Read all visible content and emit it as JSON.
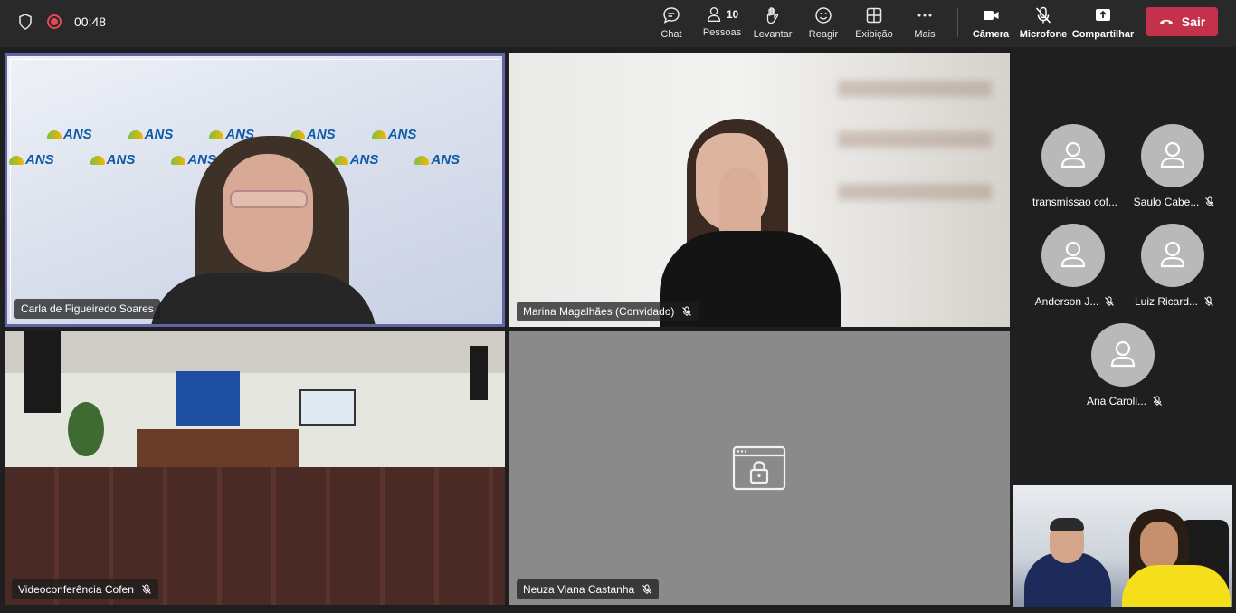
{
  "topbar": {
    "timer": "00:48",
    "buttons": {
      "chat": "Chat",
      "people": "Pessoas",
      "people_count": "10",
      "raise": "Levantar",
      "react": "Reagir",
      "view": "Exibição",
      "more": "Mais",
      "camera": "Câmera",
      "mic": "Microfone",
      "share": "Compartilhar"
    },
    "leave": "Sair",
    "leave_color": "#c4314b"
  },
  "tiles": {
    "carla": {
      "name": "Carla de Figueiredo Soares",
      "logo_text": "ANS"
    },
    "marina": {
      "name": "Marina Magalhães (Convidado)"
    },
    "cofen": {
      "name": "Videoconferência Cofen"
    },
    "neuza": {
      "name": "Neuza Viana Castanha"
    }
  },
  "roster": [
    {
      "name": "transmissao cof...",
      "muted": false
    },
    {
      "name": "Saulo Cabe...",
      "muted": true
    },
    {
      "name": "Anderson J...",
      "muted": true
    },
    {
      "name": "Luiz Ricard...",
      "muted": true
    },
    {
      "name": "Ana Caroli...",
      "muted": true
    }
  ],
  "colors": {
    "accent": "#6264a7",
    "background": "#1f1f1f",
    "topbar": "#292929"
  }
}
